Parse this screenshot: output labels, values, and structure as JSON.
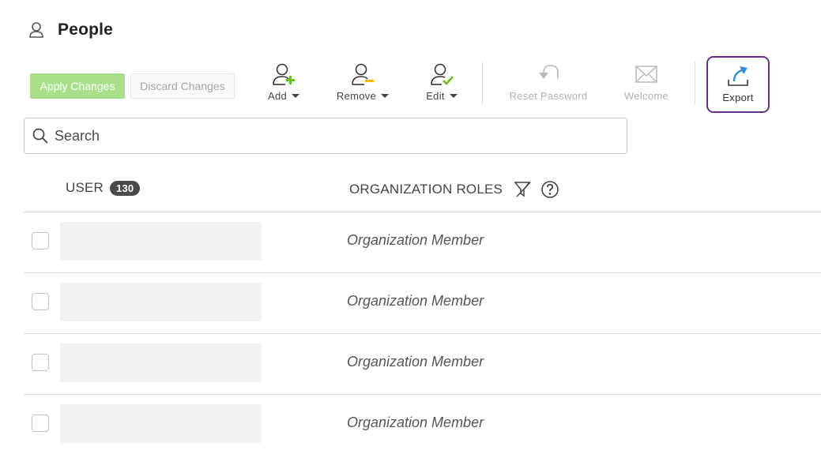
{
  "header": {
    "title": "People",
    "icon": "person-icon"
  },
  "actions": {
    "apply_label": "Apply Changes",
    "discard_label": "Discard Changes",
    "apply_color": "#a8e08a"
  },
  "toolbar": {
    "add": {
      "label": "Add",
      "icon": "add-user-icon",
      "accent": "#6abf1e"
    },
    "remove": {
      "label": "Remove",
      "icon": "remove-user-icon",
      "accent": "#f2b705"
    },
    "edit": {
      "label": "Edit",
      "icon": "edit-user-icon",
      "accent": "#6abf1e"
    },
    "reset_password": {
      "label": "Reset Password",
      "icon": "undo-arrow-icon",
      "disabled": true
    },
    "welcome": {
      "label": "Welcome",
      "icon": "envelope-icon",
      "disabled": true
    },
    "export": {
      "label": "Export",
      "icon": "export-icon",
      "highlight": "#6b2d8a",
      "accent": "#2a8be0"
    }
  },
  "search": {
    "placeholder": "Search",
    "value": ""
  },
  "table": {
    "columns": {
      "user": "USER",
      "user_count": "130",
      "roles": "ORGANIZATION ROLES"
    },
    "rows": [
      {
        "role": "Organization Member"
      },
      {
        "role": "Organization Member"
      },
      {
        "role": "Organization Member"
      },
      {
        "role": "Organization Member"
      }
    ]
  }
}
